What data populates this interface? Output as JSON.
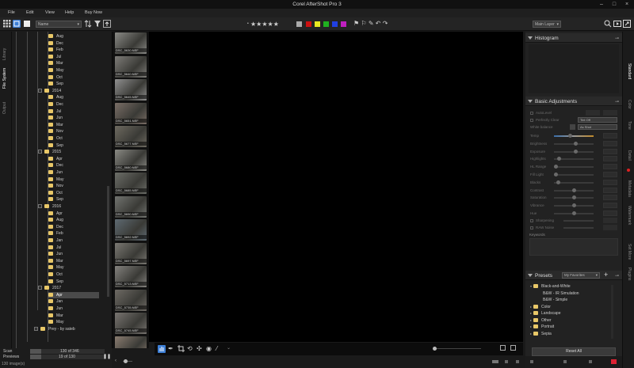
{
  "app": {
    "title": "Corel AfterShot Pro 3"
  },
  "menu": {
    "file": "File",
    "edit": "Edit",
    "view": "View",
    "help": "Help",
    "buy": "Buy Now"
  },
  "toolbar": {
    "sort_select": "Name",
    "layer_select": "Main Layer",
    "color_labels": [
      "#cc1010",
      "#e8e820",
      "#20b020",
      "#2040e0",
      "#c020c0"
    ]
  },
  "left_tabs": {
    "library": "Library",
    "filesystem": "File System",
    "output": "Output"
  },
  "tree": {
    "rows": [
      {
        "label": "Aug",
        "level": 2
      },
      {
        "label": "Dec",
        "level": 2
      },
      {
        "label": "Feb",
        "level": 2
      },
      {
        "label": "Jul",
        "level": 2
      },
      {
        "label": "Mar",
        "level": 2
      },
      {
        "label": "May",
        "level": 2
      },
      {
        "label": "Oct",
        "level": 2
      },
      {
        "label": "Sep",
        "level": 2
      },
      {
        "label": "2014",
        "level": 1,
        "exp": "−"
      },
      {
        "label": "Aug",
        "level": 2
      },
      {
        "label": "Dec",
        "level": 2
      },
      {
        "label": "Jul",
        "level": 2
      },
      {
        "label": "Jun",
        "level": 2
      },
      {
        "label": "Mar",
        "level": 2
      },
      {
        "label": "Nov",
        "level": 2
      },
      {
        "label": "Oct",
        "level": 2
      },
      {
        "label": "Sep",
        "level": 2
      },
      {
        "label": "2015",
        "level": 1,
        "exp": "−"
      },
      {
        "label": "Apr",
        "level": 2
      },
      {
        "label": "Dec",
        "level": 2
      },
      {
        "label": "Jun",
        "level": 2
      },
      {
        "label": "May",
        "level": 2
      },
      {
        "label": "Nov",
        "level": 2
      },
      {
        "label": "Oct",
        "level": 2
      },
      {
        "label": "Sep",
        "level": 2
      },
      {
        "label": "2016",
        "level": 1,
        "exp": "−"
      },
      {
        "label": "Apr",
        "level": 2
      },
      {
        "label": "Aug",
        "level": 2
      },
      {
        "label": "Dec",
        "level": 2
      },
      {
        "label": "Feb",
        "level": 2
      },
      {
        "label": "Jan",
        "level": 2
      },
      {
        "label": "Jul",
        "level": 2
      },
      {
        "label": "Jun",
        "level": 2
      },
      {
        "label": "Mar",
        "level": 2
      },
      {
        "label": "May",
        "level": 2
      },
      {
        "label": "Oct",
        "level": 2
      },
      {
        "label": "Sep",
        "level": 2
      },
      {
        "label": "2017",
        "level": 1,
        "exp": "−"
      },
      {
        "label": "Apr",
        "level": 2,
        "selected": true
      },
      {
        "label": "Jan",
        "level": 2
      },
      {
        "label": "Jun",
        "level": 2
      },
      {
        "label": "Mar",
        "level": 2
      },
      {
        "label": "May",
        "level": 2
      },
      {
        "label": "Prey - by sateb",
        "level": 0,
        "exp": "+"
      }
    ]
  },
  "filmstrip": {
    "items": [
      {
        "caption": "DSC_5630.NEF",
        "color": "#8a8a86"
      },
      {
        "caption": "DSC_5640.NEF",
        "color": "#7e7c78"
      },
      {
        "caption": "DSC_5645.NEF",
        "color": "#909090"
      },
      {
        "caption": "DSC_5651.NEF",
        "color": "#7a6e66"
      },
      {
        "caption": "DSC_5677.NEF",
        "color": "#6e6a60"
      },
      {
        "caption": "DSC_5680.NEF",
        "color": "#8a8a84"
      },
      {
        "caption": "DSC_5685.NEF",
        "color": "#6c6e68"
      },
      {
        "caption": "DSC_5690.NEF",
        "color": "#727470"
      },
      {
        "caption": "DSC_5692.NEF",
        "color": "#5e6a72"
      },
      {
        "caption": "DSC_5697.NEF",
        "color": "#7a7872"
      },
      {
        "caption": "DSC_5713.NEF",
        "color": "#84827e"
      },
      {
        "caption": "DSC_5735.NEF",
        "color": "#6e6a64"
      },
      {
        "caption": "DSC_5745.NEF",
        "color": "#787470"
      },
      {
        "caption": "DSC_5759.NEF",
        "color": "#8a7c70"
      },
      {
        "caption": "DSC_5762.NEF",
        "color": "#6e6e68"
      }
    ]
  },
  "left_status": {
    "scan_label": "Scan",
    "scan_count": "130 of 346",
    "previews_label": "Previews",
    "previews_count": "19 of 130",
    "images_count": "130 image(s)"
  },
  "histogram": {
    "title": "Histogram"
  },
  "adjustments": {
    "title": "Basic Adjustments",
    "autolevel": "AutoLevel",
    "perfectly_clear": "Perfectly Clear",
    "perfectly_clear_value": "Tint Off",
    "white_balance": "White balance",
    "white_balance_value": "As Shot",
    "rows": [
      {
        "label": "Temp",
        "knob": 0.4,
        "grad": true
      },
      {
        "label": "Brightness",
        "knob": 0.55
      },
      {
        "label": "Exposure",
        "knob": 0.55
      },
      {
        "label": "Highlights",
        "knob": 0.12
      },
      {
        "label": "HL Range",
        "knob": 0.05
      },
      {
        "label": "Fill Light",
        "knob": 0.05
      },
      {
        "label": "Blacks",
        "knob": 0.1
      },
      {
        "label": "Contrast",
        "knob": 0.5
      },
      {
        "label": "Saturation",
        "knob": 0.5
      },
      {
        "label": "Vibrance",
        "knob": 0.5
      },
      {
        "label": "Hue",
        "knob": 0.5
      }
    ],
    "sharpening": "Sharpening",
    "raw_noise": "RAW Noise",
    "keywords": "Keywords"
  },
  "presets": {
    "title": "Presets",
    "filter": "My Favorites",
    "items": [
      {
        "label": "Black-and-White",
        "level": 0,
        "folder": true,
        "open": true
      },
      {
        "label": "B&W - IR Simulation",
        "level": 1
      },
      {
        "label": "B&W - Simple",
        "level": 1
      },
      {
        "label": "Color",
        "level": 0,
        "folder": true
      },
      {
        "label": "Landscape",
        "level": 0,
        "folder": true
      },
      {
        "label": "Other",
        "level": 0,
        "folder": true
      },
      {
        "label": "Portrait",
        "level": 0,
        "folder": true
      },
      {
        "label": "Sepia",
        "level": 0,
        "folder": true
      }
    ],
    "reset_all": "Reset All"
  },
  "right_tabs": [
    "Standard",
    "Color",
    "Tone",
    "Detail",
    "Metadata",
    "Watermark",
    "Set More",
    "Plugins"
  ]
}
